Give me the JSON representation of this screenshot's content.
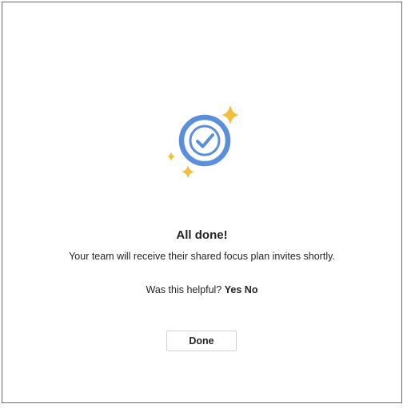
{
  "dialog": {
    "illustration_icon": "check-circle-sparkles-icon",
    "title": "All done!",
    "message": "Your team will receive their shared focus plan invites shortly.",
    "feedback": {
      "question": "Was this helpful?",
      "yes_label": "Yes",
      "no_label": "No"
    },
    "done_label": "Done"
  },
  "colors": {
    "check_circle": "#5b8fdc",
    "sparkle": "#f2be3c",
    "text": "#242424",
    "border": "#6b6b6b"
  }
}
